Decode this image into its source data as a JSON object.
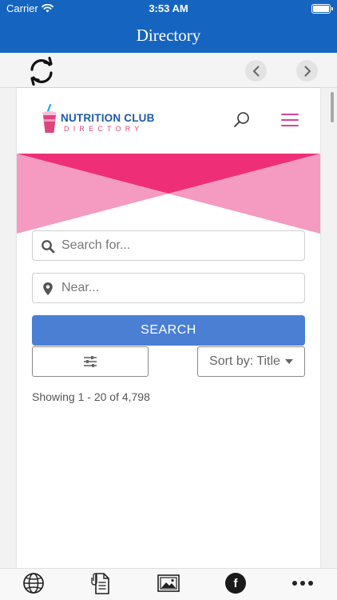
{
  "status_bar": {
    "carrier": "Carrier",
    "time": "3:53 AM"
  },
  "nav_bar": {
    "title": "Directory"
  },
  "toolbar": {
    "icons": [
      "refresh-icon",
      "chevron-left-icon",
      "chevron-right-icon"
    ]
  },
  "site": {
    "logo": {
      "line1": "NUTRITION CLUB",
      "line2": "DIRECTORY"
    },
    "colors": {
      "brand_blue": "#1e5aa8",
      "brand_pink": "#e0447f",
      "menu_pink": "#d2459a",
      "banner_dark": "#ee2f77",
      "banner_light": "#f59ac0",
      "search_button": "#4a7fd4"
    },
    "search": {
      "placeholder": "Search for..."
    },
    "near": {
      "placeholder": "Near..."
    },
    "search_button": "SEARCH",
    "sort_label": "Sort by: Title",
    "results_count": "Showing 1 - 20 of 4,798"
  },
  "app_colors": {
    "nav_blue": "#1565c0"
  },
  "tab_bar": {
    "icons": [
      "globe-icon",
      "document-icon",
      "gallery-icon",
      "facebook-icon",
      "more-icon"
    ]
  }
}
